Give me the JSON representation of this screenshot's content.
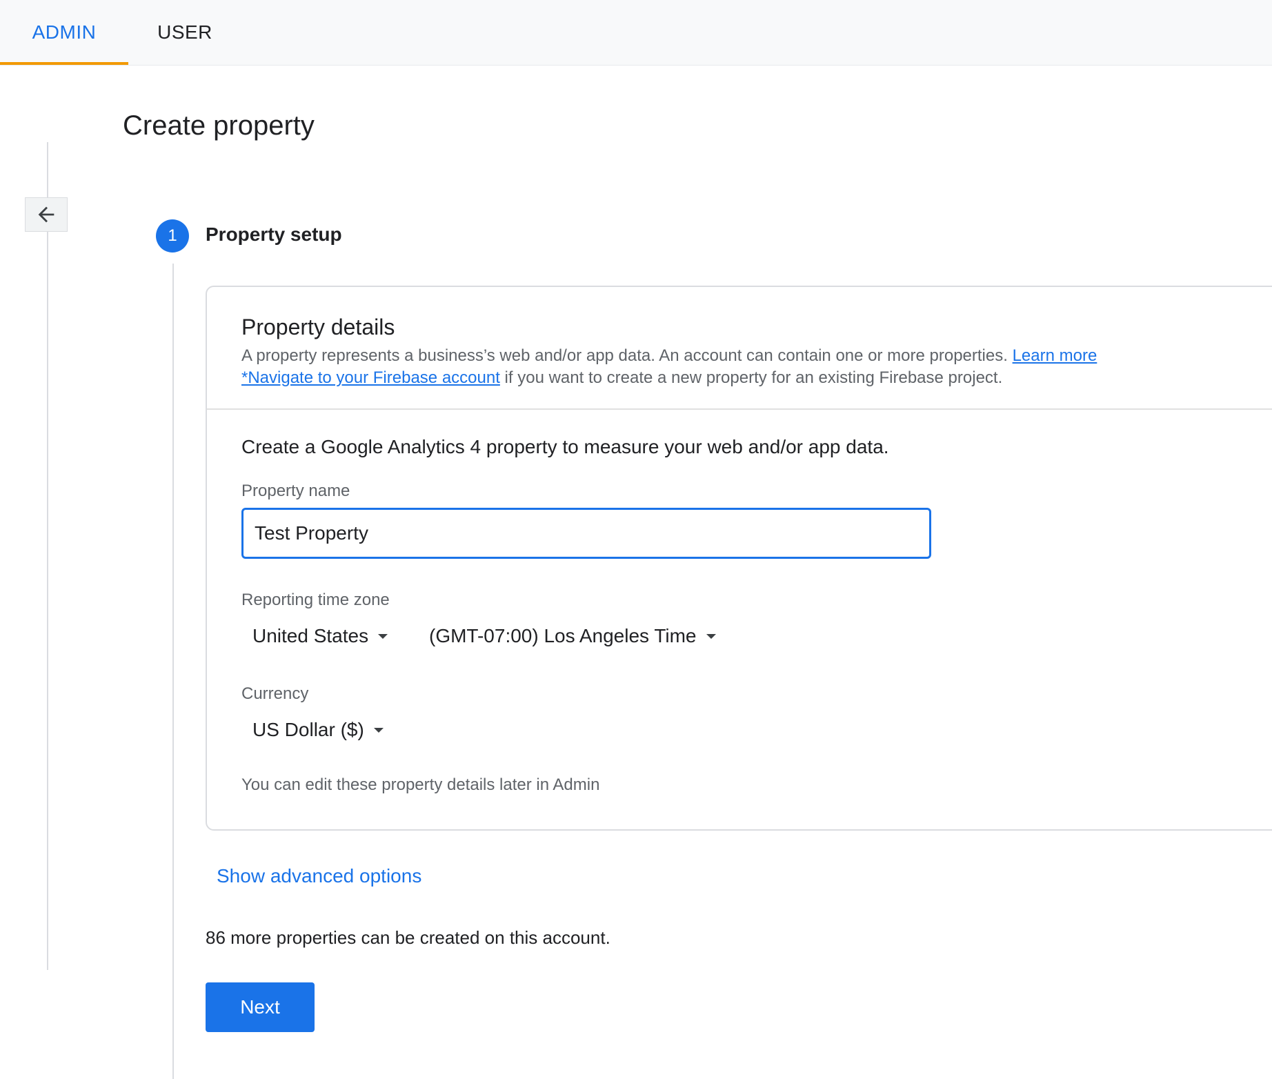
{
  "tabs": {
    "admin": "ADMIN",
    "user": "USER"
  },
  "page": {
    "title": "Create property"
  },
  "step": {
    "number": "1",
    "label": "Property setup"
  },
  "card": {
    "title": "Property details",
    "desc_line1": "A property represents a business’s web and/or app data. An account can contain one or more properties.",
    "learn_more": "Learn more",
    "firebase_link": "*Navigate to your Firebase account",
    "desc_line2_rest": "if you want to create a new property for an existing Firebase project.",
    "intro": "Create a Google Analytics 4 property to measure your web and/or app data.",
    "property_name_label": "Property name",
    "property_name_value": "Test Property",
    "timezone_label": "Reporting time zone",
    "country": "United States",
    "timezone": "(GMT-07:00) Los Angeles Time",
    "currency_label": "Currency",
    "currency": "US Dollar ($)",
    "note": "You can edit these property details later in Admin"
  },
  "advanced_link": "Show advanced options",
  "quota_text": "86 more properties can be created on this account.",
  "next_button": "Next",
  "colors": {
    "accent": "#1a73e8",
    "tab_indicator": "#f29900"
  }
}
